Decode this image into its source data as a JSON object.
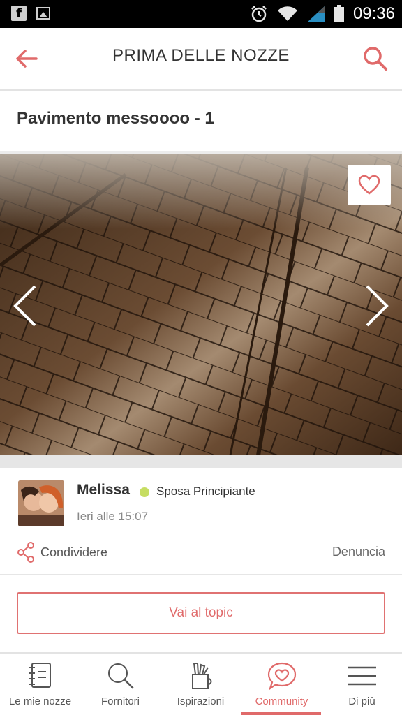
{
  "status_bar": {
    "time": "09:36",
    "icons": [
      "facebook-icon",
      "gallery-icon",
      "alarm-icon",
      "wifi-icon",
      "signal-icon",
      "battery-icon"
    ]
  },
  "app_bar": {
    "title": "PRIMA DELLE NOZZE",
    "back_icon": "back-arrow-icon",
    "search_icon": "search-icon",
    "accent_color": "#e06a6a"
  },
  "post": {
    "title": "Pavimento messoooo - 1",
    "photo_icon": "favorite-heart-icon",
    "prev_icon": "chevron-left-icon",
    "next_icon": "chevron-right-icon"
  },
  "author": {
    "name": "Melissa",
    "role": "Sposa Principiante",
    "status_color": "#c6dd62",
    "date": "Ieri alle 15:07"
  },
  "actions": {
    "share_label": "Condividere",
    "report_label": "Denuncia",
    "topic_button": "Vai al topic"
  },
  "bottom_nav": {
    "items": [
      {
        "label": "Le mie nozze",
        "icon": "notebook-icon"
      },
      {
        "label": "Fornitori",
        "icon": "search-icon"
      },
      {
        "label": "Ispirazioni",
        "icon": "pencil-cup-icon"
      },
      {
        "label": "Community",
        "icon": "chat-heart-icon",
        "active": true
      },
      {
        "label": "Di più",
        "icon": "menu-icon"
      }
    ]
  }
}
